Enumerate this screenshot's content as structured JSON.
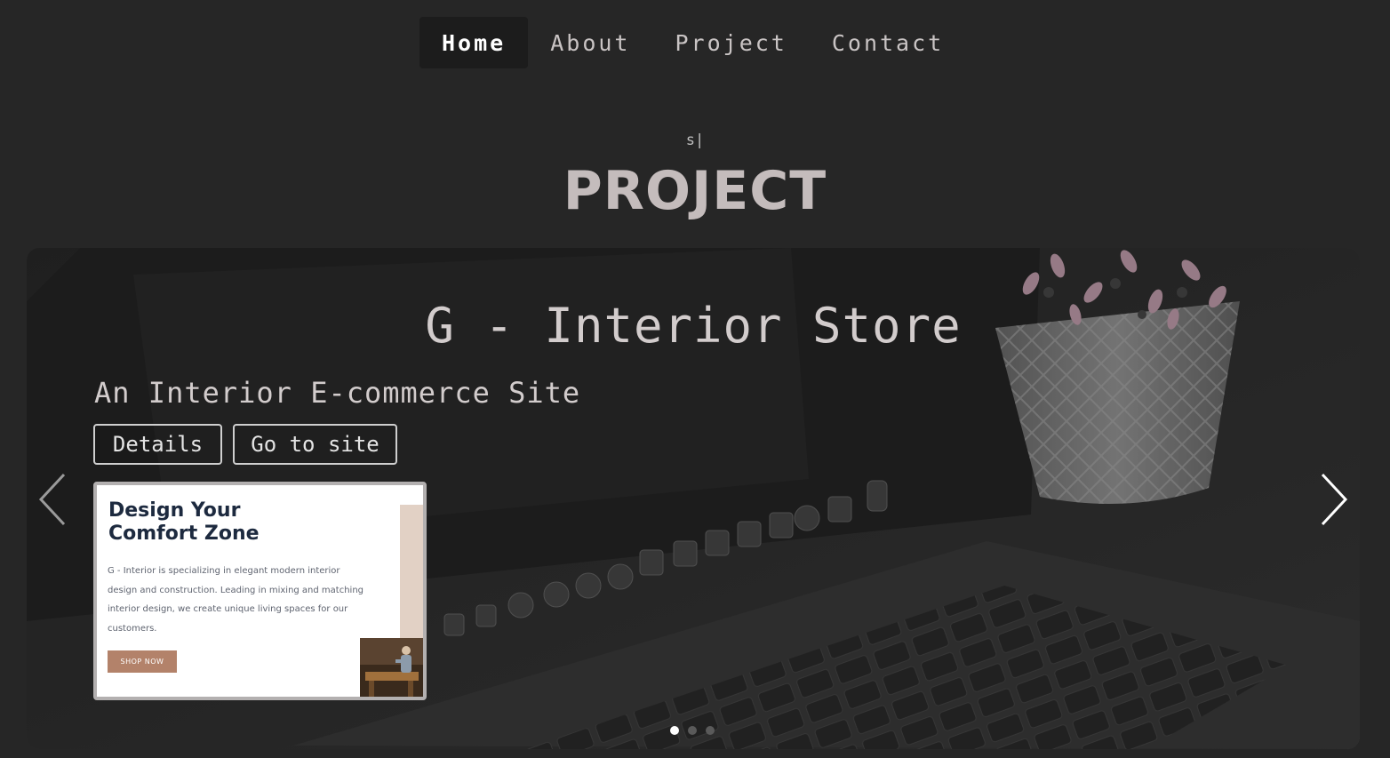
{
  "nav": {
    "items": [
      {
        "label": "Home",
        "active": true
      },
      {
        "label": "About"
      },
      {
        "label": "Project"
      },
      {
        "label": "Contact"
      }
    ]
  },
  "section": {
    "typing_text": "s|",
    "title": "PROJECT"
  },
  "carousel": {
    "slide": {
      "title": "G - Interior Store",
      "subtitle": "An Interior E-commerce Site",
      "details_label": "Details",
      "site_label": "Go to site"
    },
    "thumbnail": {
      "heading_line1": "Design Your",
      "heading_line2": "Comfort Zone",
      "paragraph": "G - Interior is specializing in elegant modern interior design and construction. Leading in mixing and matching interior design, we create unique living spaces for our customers.",
      "button_label": "SHOP NOW"
    },
    "prev_icon": "chevron-left-icon",
    "next_icon": "chevron-right-icon",
    "indicators": [
      {
        "active": true
      },
      {
        "active": false
      },
      {
        "active": false
      }
    ]
  },
  "colors": {
    "page_background": "#262626",
    "active_nav_background": "#1c1c1c",
    "title_color": "#c4bcbc",
    "thumb_heading": "#1d2a3f",
    "thumb_button": "#b3826a"
  }
}
